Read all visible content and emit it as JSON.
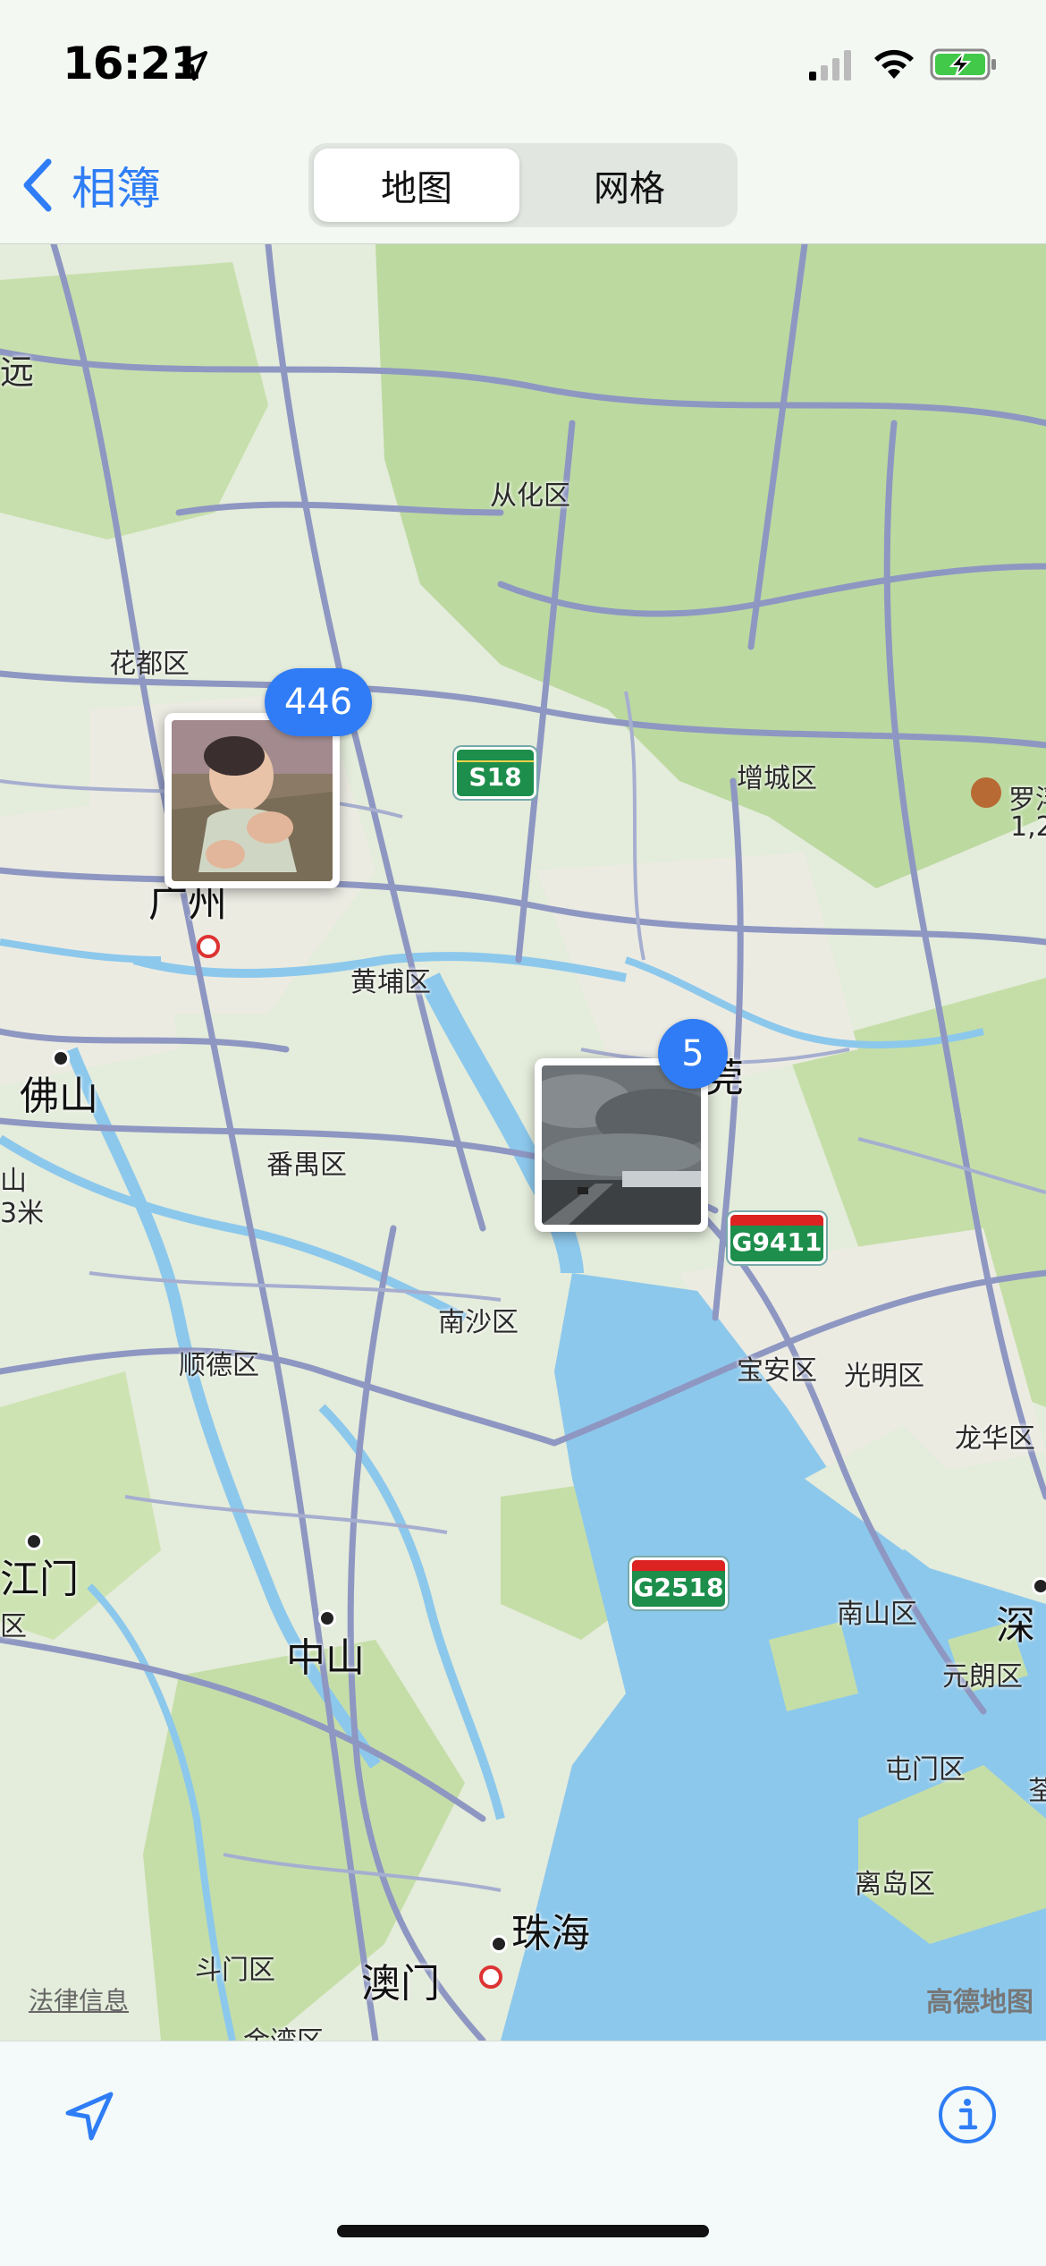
{
  "status_bar": {
    "time": "16:21"
  },
  "nav": {
    "back_label": "相簿",
    "segments": [
      "地图",
      "网格"
    ],
    "selected_segment": "地图"
  },
  "map": {
    "places": {
      "conghua": "从化区",
      "huadu": "花都区",
      "zengcheng": "增城区",
      "guangzhou": "广州",
      "huangpu": "黄埔区",
      "foshan": "佛山",
      "panyu": "番禺区",
      "dongguan_partial": "莞",
      "nansha": "南沙区",
      "shunde": "顺德区",
      "baoan": "宝安区",
      "guangming": "光明区",
      "longhua": "龙华区",
      "jiangmen_partial": "江门",
      "zhongshan": "中山",
      "nanshan": "南山区",
      "shenzhen_partial": "深",
      "yuanlang": "元朗区",
      "tunmen": "屯门区",
      "lidao": "离岛区",
      "zhuhai": "珠海",
      "macau": "澳门",
      "doumen": "斗门区",
      "jinwan_partial": "金湾区",
      "qingyuan_partial": "远",
      "luofu_partial": "罗浮",
      "luofu_elev_partial": "1,2",
      "left_edge_1": "山",
      "left_edge_2": "3米",
      "left_edge_3": "区",
      "right_edge": "荃"
    },
    "highway_shields": [
      "S18",
      "G9411",
      "G2518"
    ],
    "photo_clusters": [
      {
        "count": "446",
        "subject": "baby"
      },
      {
        "count": "5",
        "subject": "cloudy-highway"
      }
    ],
    "legal_link": "法律信息",
    "attribution": "高德地图"
  },
  "colors": {
    "accent": "#2e7df6",
    "water": "#8cc8ec",
    "land": "#dfe9d5",
    "green_area": "#bcd9a0",
    "road": "#8e97c2"
  }
}
